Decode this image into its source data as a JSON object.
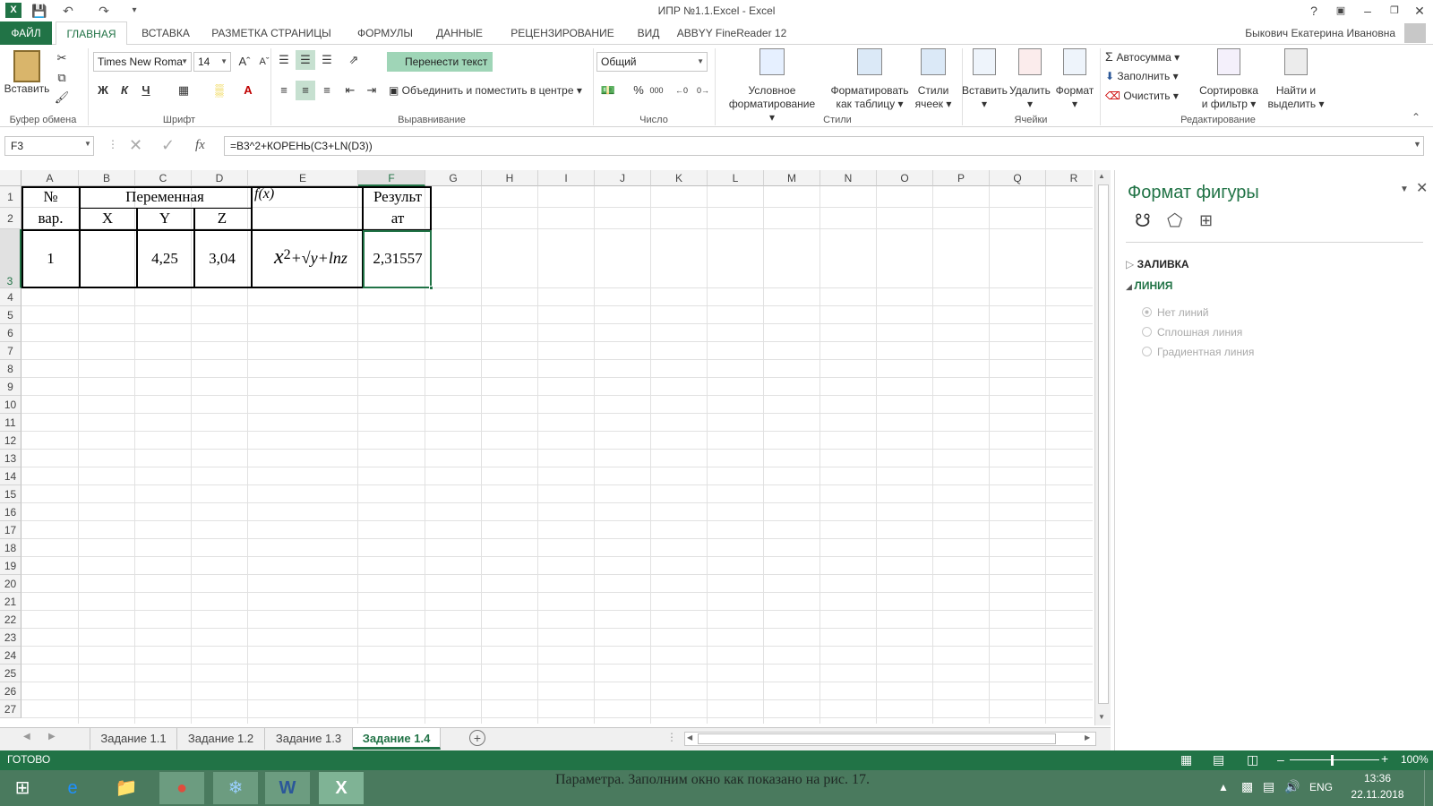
{
  "window": {
    "title": "ИПР №1.1.Excel - Excel",
    "user": "Быкович Екатерина Ивановна",
    "help": "?"
  },
  "tabs": [
    "ФАЙЛ",
    "ГЛАВНАЯ",
    "ВСТАВКА",
    "РАЗМЕТКА СТРАНИЦЫ",
    "ФОРМУЛЫ",
    "ДАННЫЕ",
    "РЕЦЕНЗИРОВАНИЕ",
    "ВИД",
    "ABBYY FineReader 12"
  ],
  "ribbon": {
    "paste": "Вставить",
    "clipboard_group": "Буфер обмена",
    "font_name": "Times New Roma",
    "font_size": "14",
    "bold": "Ж",
    "italic": "К",
    "underline": "Ч",
    "font_group": "Шрифт",
    "wrap_text": "Перенести текст",
    "merge_center": "Объединить и поместить в центре",
    "align_group": "Выравнивание",
    "number_format": "Общий",
    "number_group": "Число",
    "percent": "%",
    "thousands": "000",
    "cond_format_1": "Условное",
    "cond_format_2": "форматирование",
    "format_table_1": "Форматировать",
    "format_table_2": "как таблицу",
    "cell_styles_1": "Стили",
    "cell_styles_2": "ячеек",
    "styles_group": "Стили",
    "insert": "Вставить",
    "delete": "Удалить",
    "format": "Формат",
    "cells_group": "Ячейки",
    "autosum": "Автосумма",
    "fill": "Заполнить",
    "clear": "Очистить",
    "sort_1": "Сортировка",
    "sort_2": "и фильтр",
    "find_1": "Найти и",
    "find_2": "выделить",
    "edit_group": "Редактирование"
  },
  "formula_bar": {
    "name_box": "F3",
    "formula": "=B3^2+КОРЕНЬ(C3+LN(D3))",
    "fx": "fx"
  },
  "columns": [
    "A",
    "B",
    "C",
    "D",
    "E",
    "F",
    "G",
    "H",
    "I",
    "J",
    "K",
    "L",
    "M",
    "N",
    "O",
    "P",
    "Q",
    "R"
  ],
  "rows": [
    "1",
    "2",
    "3",
    "4",
    "5",
    "6",
    "7",
    "8",
    "9",
    "10",
    "11",
    "12",
    "13",
    "14",
    "15",
    "16",
    "17",
    "18",
    "19",
    "20",
    "21",
    "22",
    "23",
    "24",
    "25",
    "26",
    "27"
  ],
  "sheet": {
    "a1": "№",
    "a2": "вар.",
    "b1": "Переменная",
    "b2": "X",
    "c2": "Y",
    "d2": "Z",
    "e1": "f(x)",
    "f1": "Результ",
    "f1b": "ат",
    "a3": "1",
    "c3": "4,25",
    "d3": "3,04",
    "f3": "2,31557",
    "formula_x": "x",
    "formula_2": "2",
    "formula_rest": "+√y+lnz"
  },
  "sheet_tabs": [
    "Задание 1.1",
    "Задание 1.2",
    "Задание 1.3",
    "Задание 1.4"
  ],
  "active_sheet": "Задание 1.4",
  "status": {
    "ready": "ГОТОВО",
    "zoom": "100%"
  },
  "pane": {
    "title": "Формат фигуры",
    "fill_section": "ЗАЛИВКА",
    "line_section": "ЛИНИЯ",
    "opt_none": "Нет линий",
    "opt_solid": "Сплошная линия",
    "opt_gradient": "Градиентная линия"
  },
  "taskbar": {
    "lang": "ENG",
    "time": "13:36",
    "date": "22.11.2018",
    "bg_text": "Параметра. Заполним окно как показано на рис. 17."
  },
  "colors": {
    "accent": "#217346",
    "selected_tab": "#9fd5b7"
  }
}
